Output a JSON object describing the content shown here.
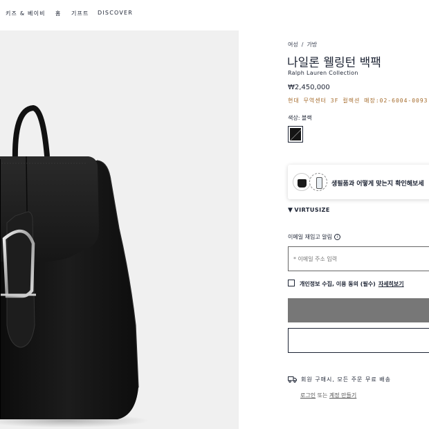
{
  "nav": {
    "items": [
      "키즈 & 베이비",
      "홈",
      "기프트",
      "DISCOVER"
    ]
  },
  "breadcrumb": {
    "level1": "여성",
    "separator": "/",
    "level2": "가방"
  },
  "product": {
    "title": "나일론 웰링턴 백팩",
    "brand": "Ralph Lauren Collection",
    "price": "₩2,450,000",
    "store_info": "현대 무역센터 3F 컬렉션 매장:02-6004-0093",
    "color_label": "색상: 블랙",
    "color_swatch_icon": "black-swatch"
  },
  "virtusize": {
    "prompt": "생필품과 어떻게 맞는지 확인해보세",
    "logo_text": "VIRTUSIZE"
  },
  "restock": {
    "label": "이메일 재입고 알림",
    "email_placeholder": "* 이메일 주소 입력",
    "consent_text": "개인정보 수집, 이용 동의 (필수)",
    "consent_link": "자세히보기"
  },
  "shipping": {
    "text": "회원 구매시, 모든 주문 무료 배송",
    "login_link": "로그인",
    "or_text": "또는",
    "create_account_link": "계정 만들기"
  },
  "colors": {
    "accent": "#a46a2a",
    "text": "#1c2333",
    "button_grey": "#777777",
    "image_bg": "#f0f0f0"
  }
}
